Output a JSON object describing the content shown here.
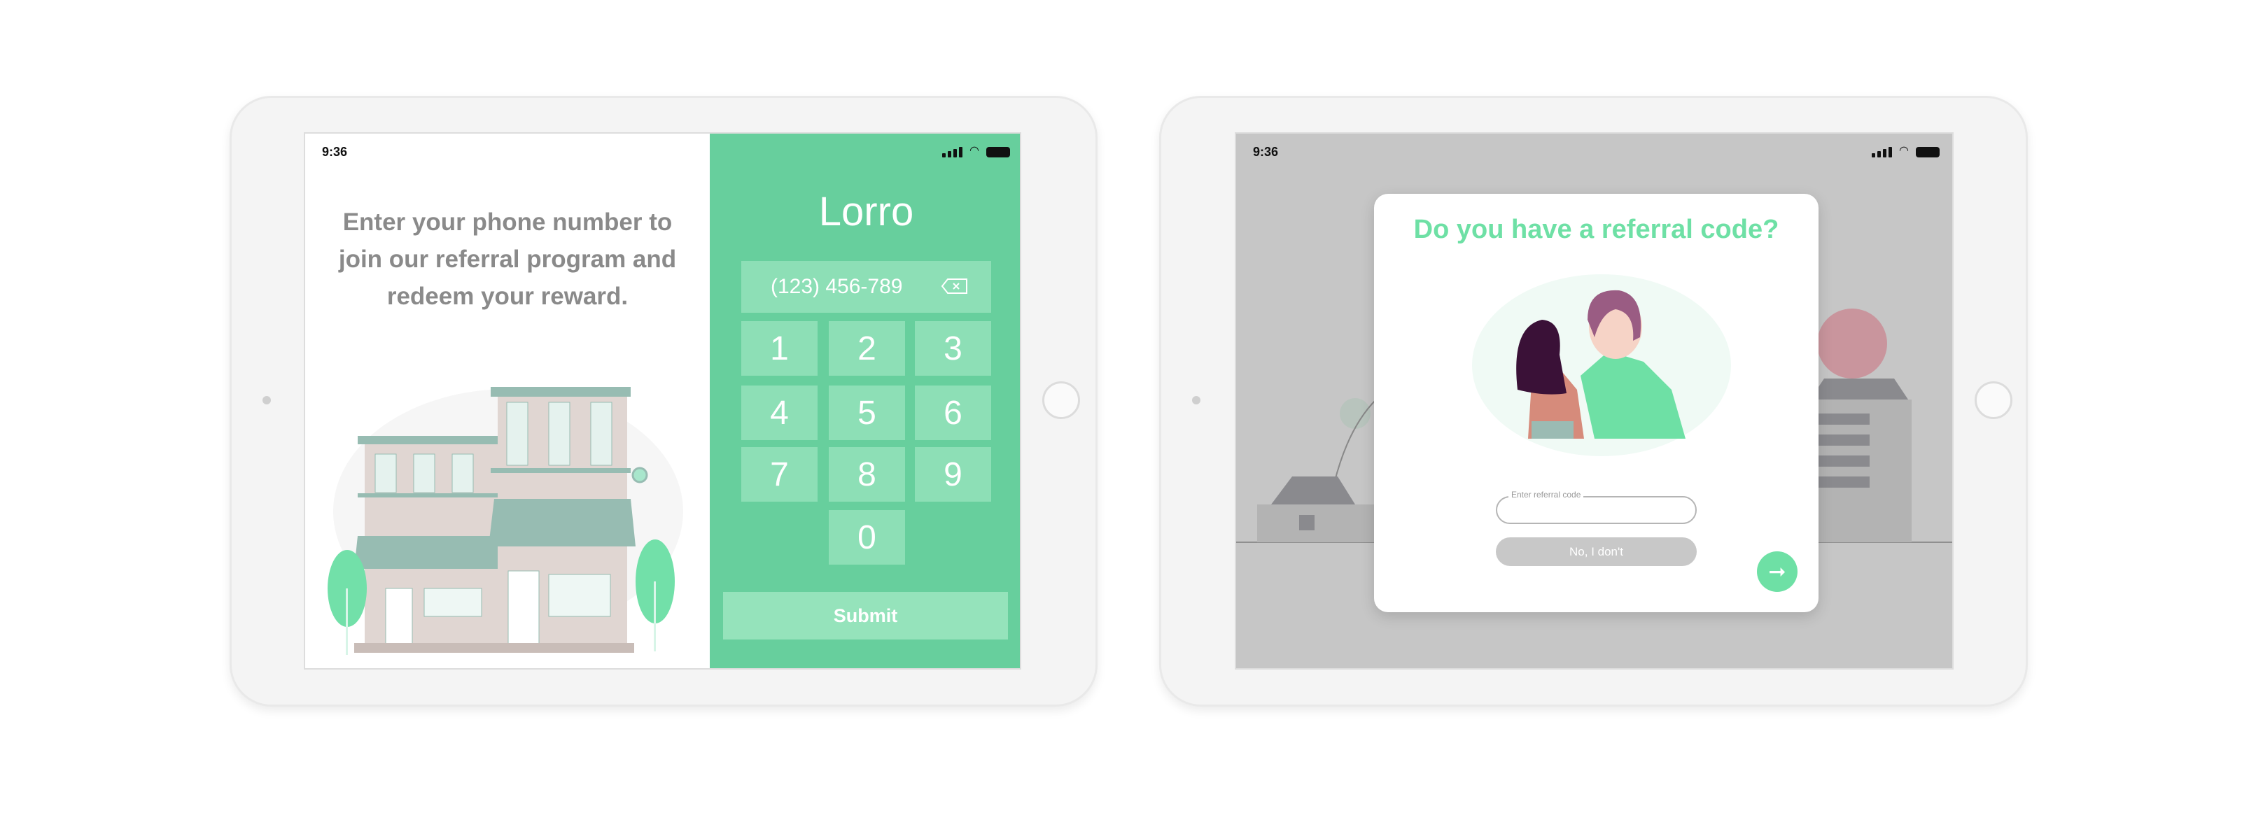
{
  "left_screen": {
    "status": {
      "time": "9:36"
    },
    "intro_lines": [
      "Enter your phone number to",
      "join our referral program and",
      "redeem your reward."
    ],
    "brand": "Lorro",
    "phone_value": "(123) 456-789",
    "keys": [
      "1",
      "2",
      "3",
      "4",
      "5",
      "6",
      "7",
      "8",
      "9",
      "0"
    ],
    "submit_label": "Submit",
    "colors": {
      "panel": "#67cf9d",
      "key": "#8ddfb6",
      "text": "#8a8a8a"
    }
  },
  "right_screen": {
    "status": {
      "time": "9:36"
    },
    "modal": {
      "title": "Do you have a referral code?",
      "code_label": "Enter referral code",
      "code_value": "",
      "no_label": "No, I don't",
      "next_icon": "arrow-right-icon"
    },
    "colors": {
      "accent": "#6ee0a5",
      "overlay": "#c6c6c6"
    }
  }
}
